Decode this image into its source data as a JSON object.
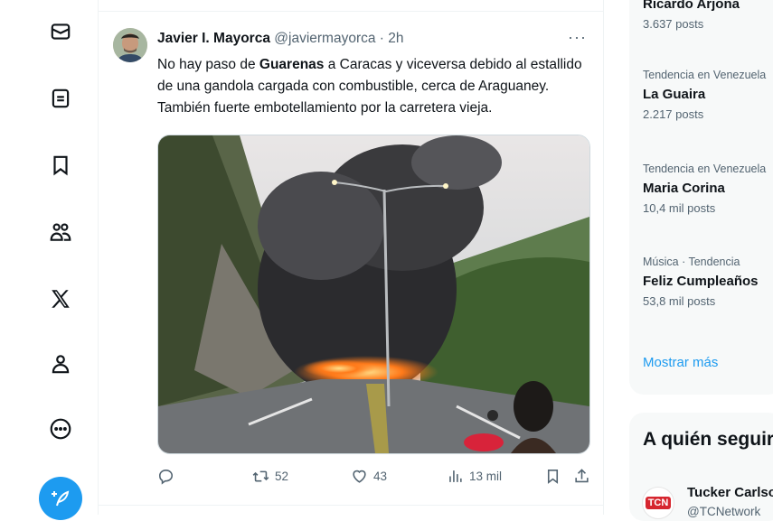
{
  "nav": {
    "items": [
      {
        "name": "messages",
        "icon": "envelope-icon"
      },
      {
        "name": "lists",
        "icon": "list-document-icon"
      },
      {
        "name": "bookmarks",
        "icon": "bookmark-icon"
      },
      {
        "name": "communities",
        "icon": "people-icon"
      },
      {
        "name": "premium",
        "icon": "x-logo-icon"
      },
      {
        "name": "profile",
        "icon": "person-icon"
      },
      {
        "name": "more",
        "icon": "more-circle-icon"
      }
    ],
    "post_icon": "feather-plus-icon"
  },
  "tweet": {
    "author_name": "Javier I. Mayorca",
    "handle": "@javiermayorca",
    "separator": "·",
    "time": "2h",
    "more": "···",
    "text_before": "No hay paso de ",
    "text_bold": "Guarenas",
    "text_after": " a Caracas y viceversa debido al estallido de una gandola cargada con combustible, cerca de Araguaney. También fuerte embotellamiento por la carretera vieja.",
    "actions": {
      "reply_count": "",
      "retweet_count": "52",
      "like_count": "43",
      "views_count": "13 mil"
    }
  },
  "trends": [
    {
      "context": "",
      "title": "Ricardo Arjona",
      "count": "3.637 posts"
    },
    {
      "context": "Tendencia en Venezuela",
      "title": "La Guaira",
      "count": "2.217 posts"
    },
    {
      "context": "Tendencia en Venezuela",
      "title": "Maria Corina",
      "count": "10,4 mil posts"
    },
    {
      "context": "Música · Tendencia",
      "title": "Feliz Cumpleaños",
      "count": "53,8 mil posts"
    }
  ],
  "show_more": "Mostrar más",
  "who_to_follow": {
    "heading": "A quién seguir",
    "user_name": "Tucker Carlson",
    "user_handle": "@TCNetwork",
    "logo_text": "TCN"
  },
  "colors": {
    "accent": "#1d9bf0",
    "secondary_text": "#536471",
    "brand_red": "#d6262f"
  }
}
